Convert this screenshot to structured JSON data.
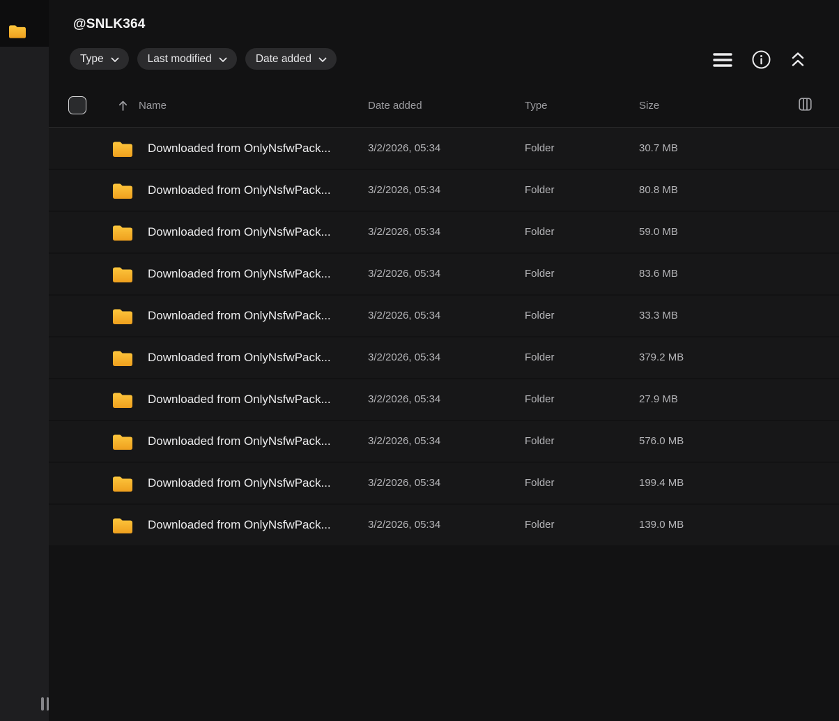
{
  "sidebar": {
    "active_item": {
      "icon": "folder-icon",
      "label": "files-root"
    },
    "resize_handle": "sidebar-resize-handle"
  },
  "header": {
    "title": "@SNLK364",
    "filters": [
      {
        "label": "Type",
        "icon": "chevron-down-icon"
      },
      {
        "label": "Last modified",
        "icon": "chevron-down-icon"
      },
      {
        "label": "Date added",
        "icon": "chevron-down-icon"
      }
    ],
    "actions": [
      {
        "name": "list-view",
        "icon": "list-lines-icon"
      },
      {
        "name": "info",
        "icon": "info-circle-icon"
      },
      {
        "name": "collapse",
        "icon": "double-chevron-up-icon"
      }
    ]
  },
  "table": {
    "columns": {
      "name": "Name",
      "date_added": "Date added",
      "type": "Type",
      "size": "Size"
    },
    "sort": {
      "column": "Name",
      "direction": "ascending",
      "icon": "arrow-up-icon"
    },
    "columns_button_icon": "columns-icon",
    "rows": [
      {
        "name": "Downloaded from OnlyNsfwPack...",
        "date_added": "3/2/2026, 05:34",
        "type": "Folder",
        "size": "30.7 MB"
      },
      {
        "name": "Downloaded from OnlyNsfwPack...",
        "date_added": "3/2/2026, 05:34",
        "type": "Folder",
        "size": "80.8 MB"
      },
      {
        "name": "Downloaded from OnlyNsfwPack...",
        "date_added": "3/2/2026, 05:34",
        "type": "Folder",
        "size": "59.0 MB"
      },
      {
        "name": "Downloaded from OnlyNsfwPack...",
        "date_added": "3/2/2026, 05:34",
        "type": "Folder",
        "size": "83.6 MB"
      },
      {
        "name": "Downloaded from OnlyNsfwPack...",
        "date_added": "3/2/2026, 05:34",
        "type": "Folder",
        "size": "33.3 MB"
      },
      {
        "name": "Downloaded from OnlyNsfwPack...",
        "date_added": "3/2/2026, 05:34",
        "type": "Folder",
        "size": "379.2 MB"
      },
      {
        "name": "Downloaded from OnlyNsfwPack...",
        "date_added": "3/2/2026, 05:34",
        "type": "Folder",
        "size": "27.9 MB"
      },
      {
        "name": "Downloaded from OnlyNsfwPack...",
        "date_added": "3/2/2026, 05:34",
        "type": "Folder",
        "size": "576.0 MB"
      },
      {
        "name": "Downloaded from OnlyNsfwPack...",
        "date_added": "3/2/2026, 05:34",
        "type": "Folder",
        "size": "199.4 MB"
      },
      {
        "name": "Downloaded from OnlyNsfwPack...",
        "date_added": "3/2/2026, 05:34",
        "type": "Folder",
        "size": "139.0 MB"
      }
    ]
  },
  "colors": {
    "folder_top": "#fdc63d",
    "folder_bottom": "#efa01e",
    "page_bg": "#121213",
    "sidebar_bg": "#1e1e20",
    "row_bg": "#171718",
    "chip_bg": "#2b2b2d",
    "primary_text": "#ebebec",
    "secondary_text": "#b4b4b7",
    "header_text": "#9c9ca0"
  }
}
